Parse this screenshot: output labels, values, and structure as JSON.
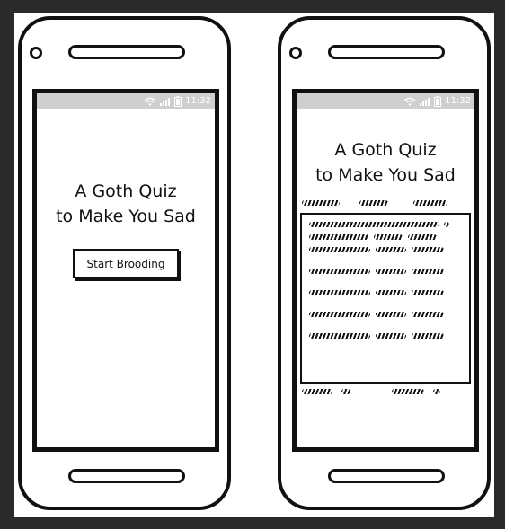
{
  "phones": [
    {
      "status": {
        "time": "11:32"
      },
      "title_line1": "A Goth Quiz",
      "title_line2": "to Make You Sad",
      "start_button": "Start Brooding"
    },
    {
      "status": {
        "time": "11:32"
      },
      "title_line1": "A Goth Quiz",
      "title_line2": "to Make You Sad"
    }
  ],
  "icons": {
    "wifi": "wifi-icon",
    "signal": "signal-icon",
    "battery": "battery-icon"
  },
  "colors": {
    "statusbar": "#cfcfcf",
    "ink": "#111111"
  }
}
